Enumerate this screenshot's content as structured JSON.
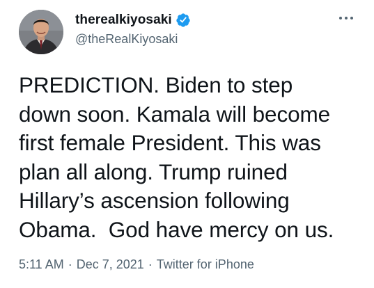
{
  "author": {
    "display_name": "therealkiyosaki",
    "handle": "@theRealKiyosaki",
    "verified": true
  },
  "tweet": {
    "text": "PREDICTION. Biden to step\ndown soon. Kamala will become\nfirst female President. This was\nplan all along. Trump ruined\nHillary’s ascension following\nObama.  God have mercy on us.",
    "time": "5:11 AM",
    "date": "Dec 7, 2021",
    "source": "Twitter for iPhone",
    "separator": "·"
  },
  "icons": {
    "verified": "verified-badge-icon",
    "more": "more-options-icon"
  },
  "colors": {
    "verified_blue": "#1d9bf0",
    "secondary_text": "#536471",
    "primary_text": "#0f1419"
  }
}
